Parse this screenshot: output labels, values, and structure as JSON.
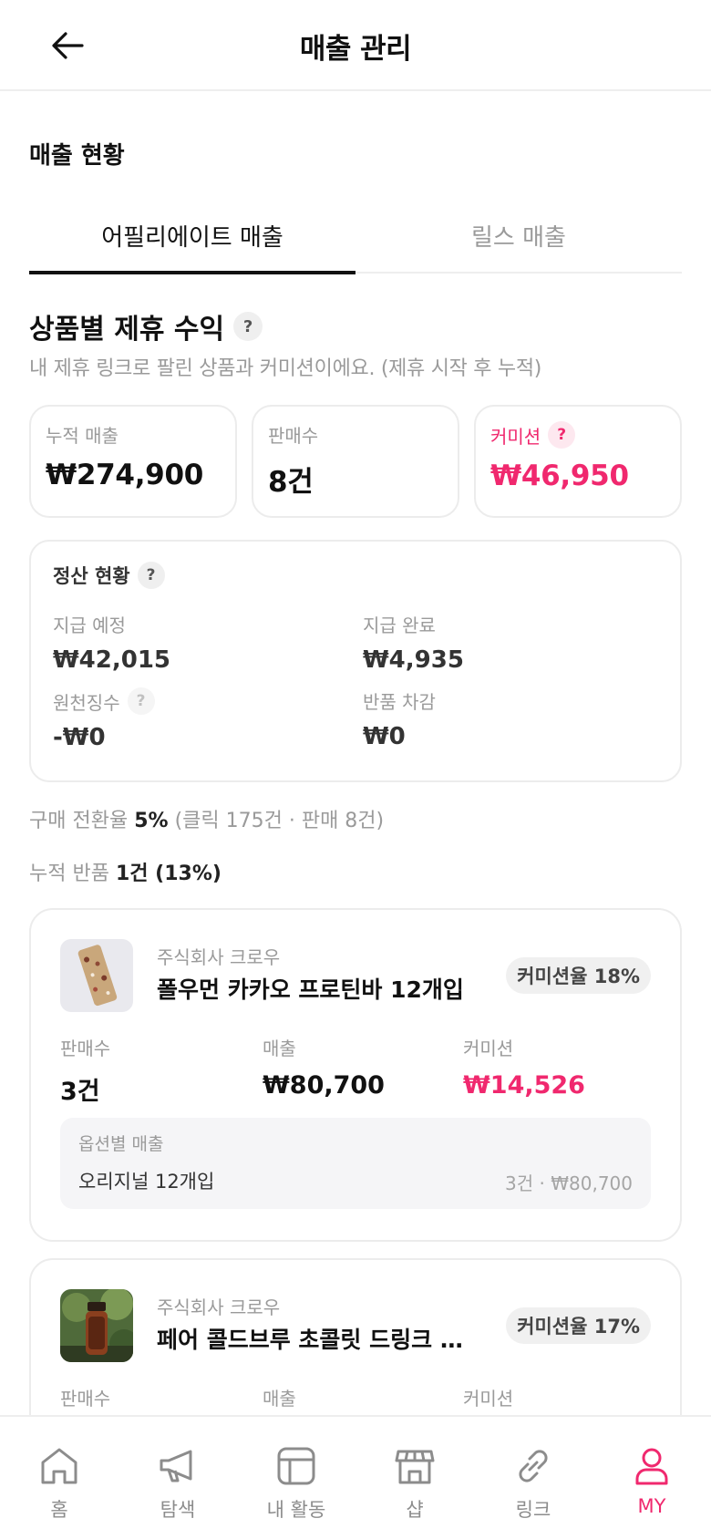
{
  "header": {
    "title": "매출 관리"
  },
  "section": {
    "title": "매출 현황"
  },
  "tabs": [
    {
      "label": "어필리에이트 매출",
      "active": true
    },
    {
      "label": "릴스 매출",
      "active": false
    }
  ],
  "profit": {
    "title": "상품별 제휴 수익",
    "help": "?",
    "description": "내 제휴 링크로 팔린 상품과 커미션이에요. (제휴 시작 후 누적)"
  },
  "stats": {
    "cumulative_sales": {
      "label": "누적 매출",
      "value": "₩274,900"
    },
    "sales_count": {
      "label": "판매수",
      "value": "8건"
    },
    "commission": {
      "label": "커미션",
      "help": "?",
      "value": "₩46,950"
    }
  },
  "settlement": {
    "title": "정산 현황",
    "help": "?",
    "scheduled": {
      "label": "지급 예정",
      "value": "₩42,015"
    },
    "completed": {
      "label": "지급 완료",
      "value": "₩4,935"
    },
    "withholding": {
      "label": "원천징수",
      "help": "?",
      "value": "-₩0"
    },
    "return_deduction": {
      "label": "반품 차감",
      "value": "₩0"
    }
  },
  "conversion": {
    "label": "구매 전환율",
    "value": "5%",
    "detail": "(클릭 175건 · 판매 8건)"
  },
  "returns": {
    "label": "누적 반품",
    "value": "1건 (13%)"
  },
  "products": [
    {
      "company": "주식회사 크로우",
      "name": "폴우먼 카카오 프로틴바 12개입",
      "rate": "커미션율 18%",
      "sales_label": "판매수",
      "sales": "3건",
      "revenue_label": "매출",
      "revenue": "₩80,700",
      "commission_label": "커미션",
      "commission": "₩14,526",
      "option_header": "옵션별 매출",
      "option_name": "오리지널 12개입",
      "option_value": "3건 · ₩80,700"
    },
    {
      "company": "주식회사 크로우",
      "name": "페어 콜드브루 초콜릿 드링크 1...",
      "rate": "커미션율 17%",
      "sales_label": "판매수",
      "revenue_label": "매출",
      "commission_label": "커미션"
    }
  ],
  "nav": [
    {
      "label": "홈",
      "icon": "home-icon"
    },
    {
      "label": "탐색",
      "icon": "megaphone-icon"
    },
    {
      "label": "내 활동",
      "icon": "layout-icon"
    },
    {
      "label": "샵",
      "icon": "store-icon"
    },
    {
      "label": "링크",
      "icon": "link-icon"
    },
    {
      "label": "MY",
      "icon": "user-icon",
      "active": true
    }
  ],
  "colors": {
    "accent": "#f0286e",
    "muted": "#9a9a9a",
    "border": "#ececec"
  }
}
